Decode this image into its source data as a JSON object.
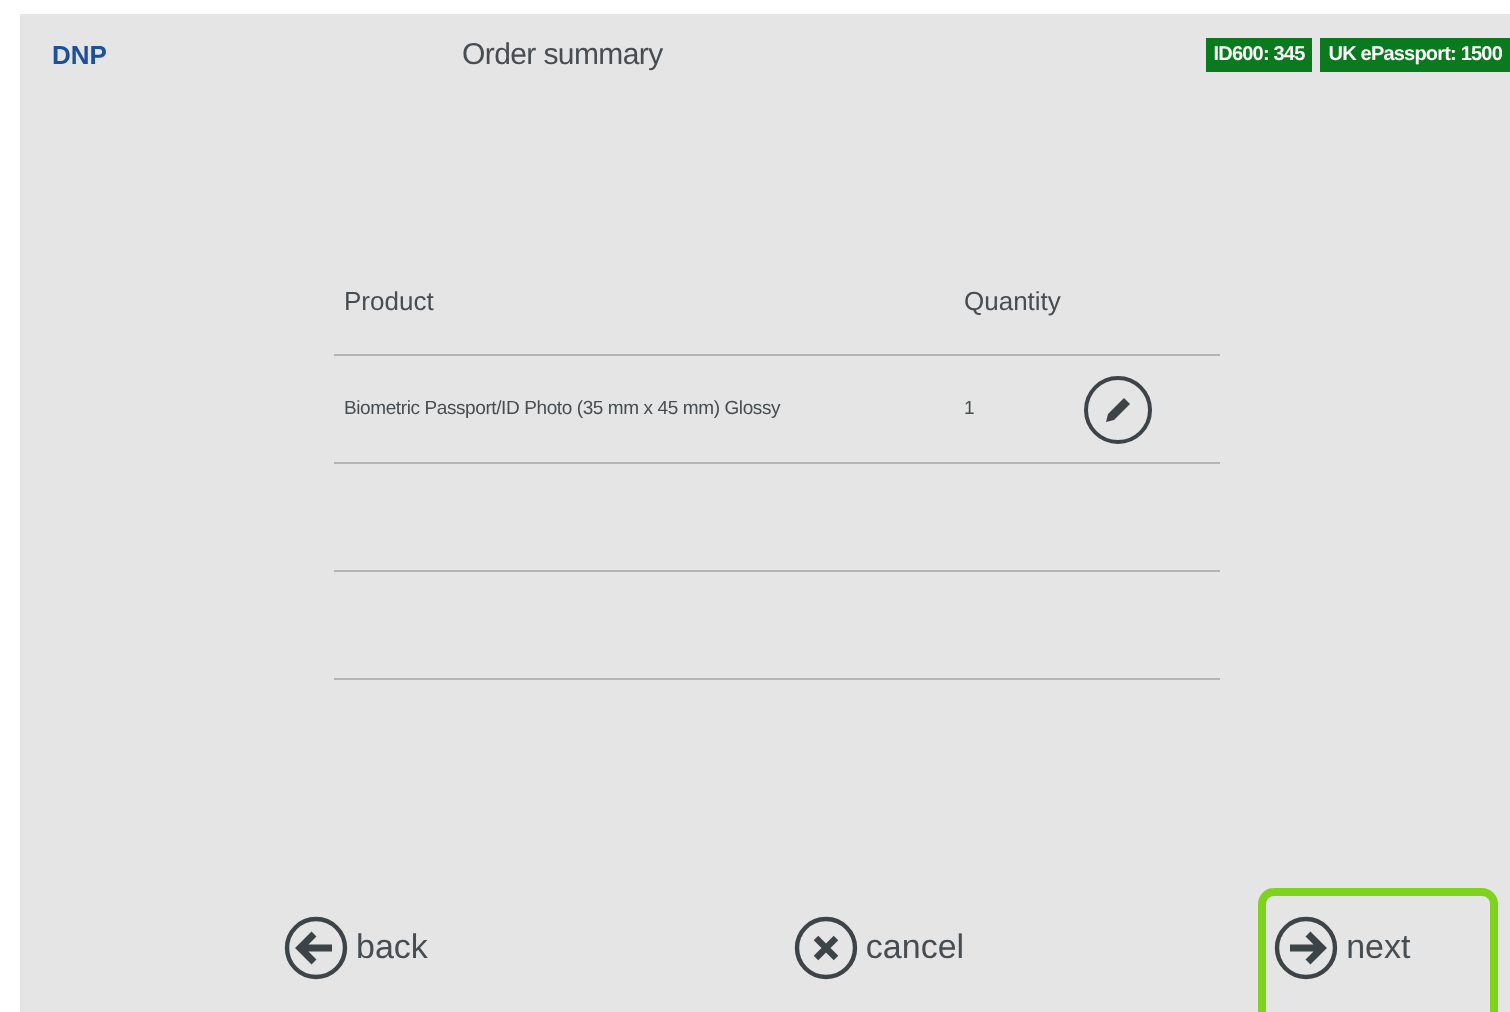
{
  "header": {
    "logo": "DNP",
    "title": "Order summary",
    "badges": [
      "ID600: 345",
      "UK ePassport: 1500"
    ]
  },
  "table": {
    "columns": [
      "Product",
      "Quantity"
    ],
    "rows": [
      {
        "product": "Biometric Passport/ID Photo (35 mm x 45 mm) Glossy",
        "quantity": "1"
      }
    ]
  },
  "footer": {
    "buttons": [
      {
        "kind": "back",
        "label": "back",
        "selected": false
      },
      {
        "kind": "cancel",
        "label": "cancel",
        "selected": false
      },
      {
        "kind": "next",
        "label": "next",
        "selected": true
      }
    ]
  }
}
